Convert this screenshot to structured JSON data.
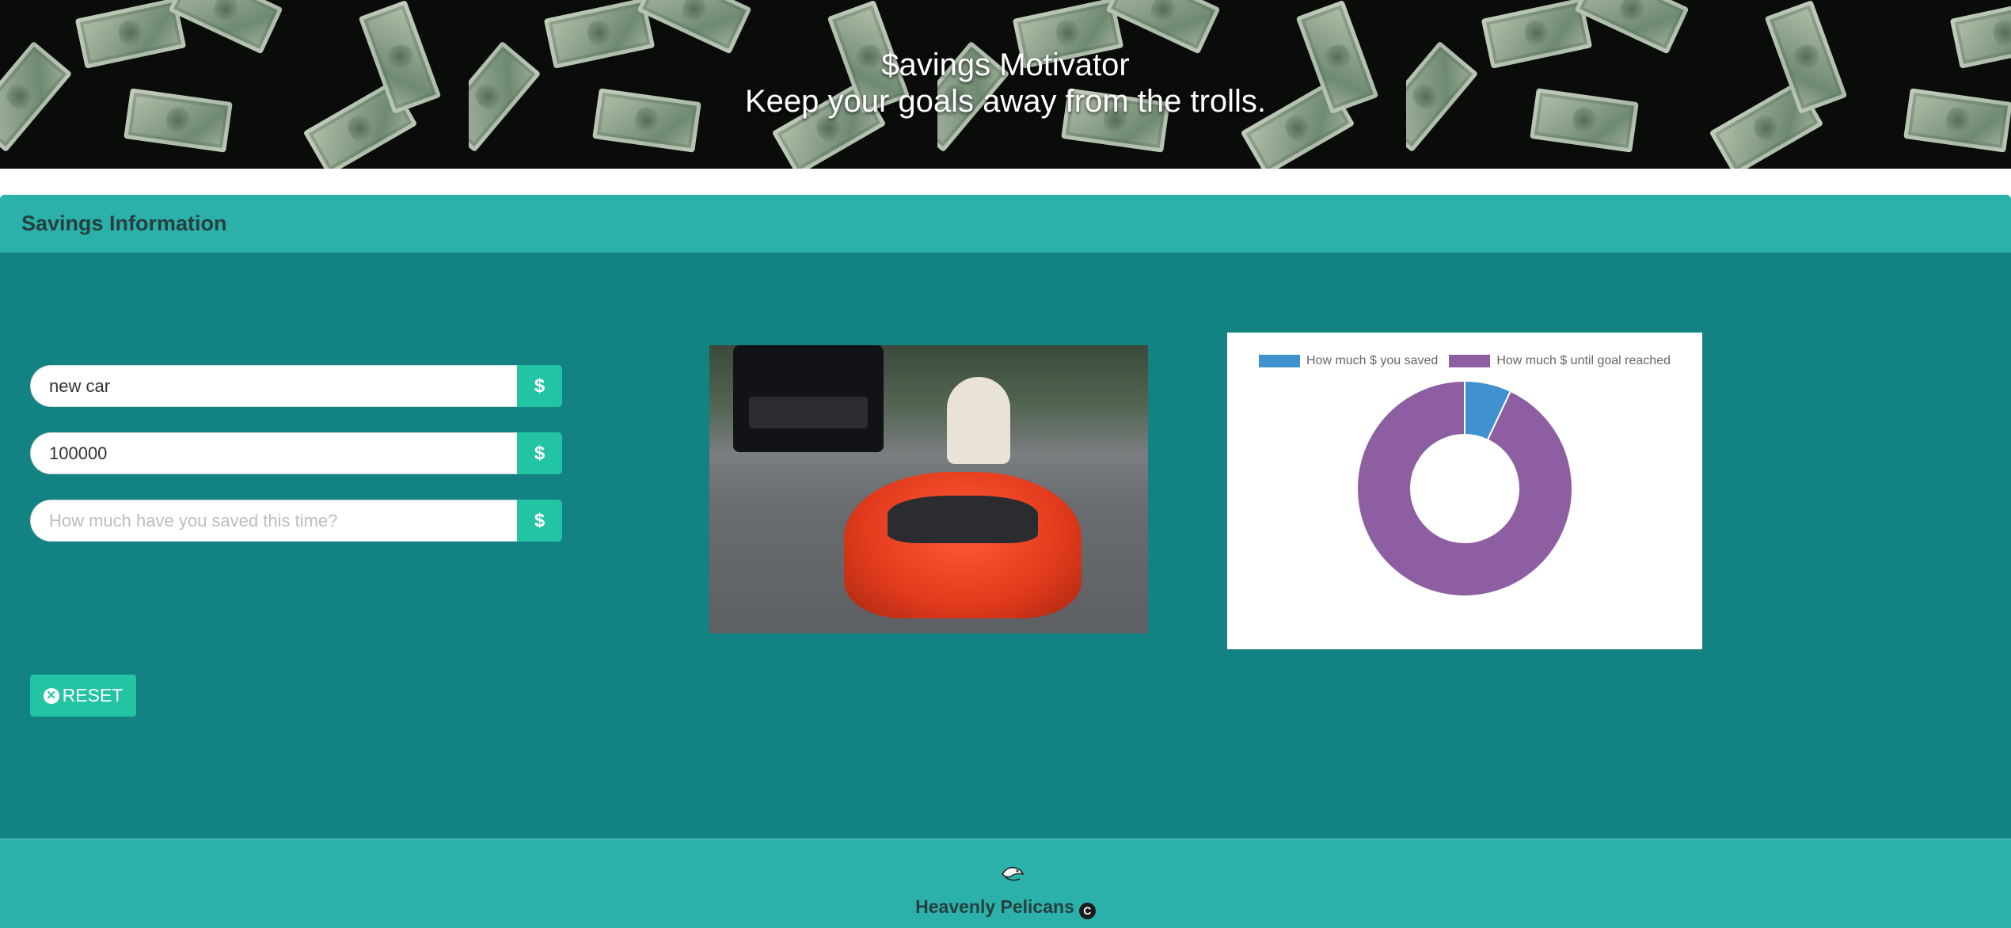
{
  "hero": {
    "title": "$avings Motivator",
    "subtitle": "Keep your goals away from the trolls."
  },
  "panel": {
    "title": "Savings Information",
    "fields": [
      {
        "value": "new car",
        "placeholder": "",
        "addon": "$"
      },
      {
        "value": "100000",
        "placeholder": "",
        "addon": "$"
      },
      {
        "value": "",
        "placeholder": "How much have you saved this time?",
        "addon": "$"
      }
    ],
    "reset_label": "RESET"
  },
  "chart_data": {
    "type": "doughnut",
    "series": [
      {
        "name": "How much $ you saved",
        "value": 7,
        "color": "#3f91cf"
      },
      {
        "name": "How much $ until goal reached",
        "value": 93,
        "color": "#8e5ea2"
      }
    ],
    "legend_position": "top"
  },
  "footer": {
    "credit": "Heavenly Pelicans",
    "copyright_symbol": "C"
  }
}
